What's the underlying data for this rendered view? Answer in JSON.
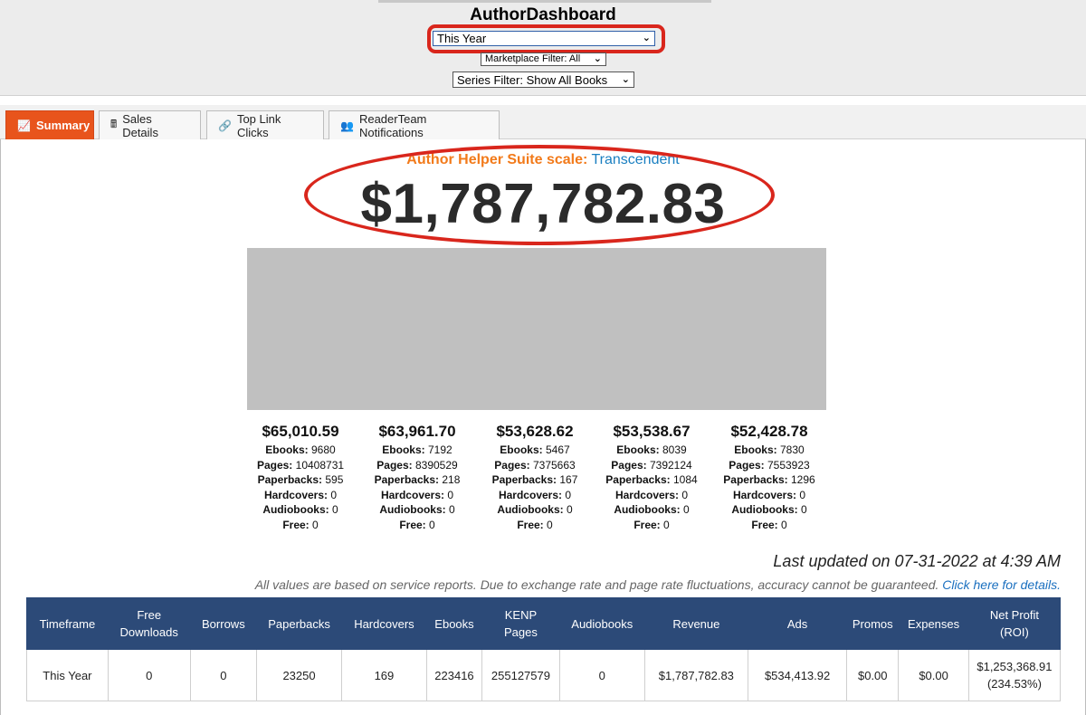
{
  "header": {
    "title": "AuthorDashboard",
    "timeframe_select": "This Year",
    "marketplace_select": "Marketplace Filter: All",
    "series_select": "Series Filter: Show All Books"
  },
  "tabs": [
    {
      "label": "Summary",
      "icon": "chart-line-icon",
      "active": true
    },
    {
      "label": "Sales Details",
      "icon": "cash-register-icon"
    },
    {
      "label": "Top Link Clicks",
      "icon": "link-icon"
    },
    {
      "label": "ReaderTeam Notifications",
      "icon": "people-icon"
    }
  ],
  "summary": {
    "scale_label": "Author Helper Suite scale:",
    "scale_value": "Transcendent",
    "total": "$1,787,782.83"
  },
  "cards": [
    {
      "amount": "$65,010.59",
      "ebooks": "9680",
      "pages": "10408731",
      "paperbacks": "595",
      "hardcovers": "0",
      "audiobooks": "0",
      "free": "0"
    },
    {
      "amount": "$63,961.70",
      "ebooks": "7192",
      "pages": "8390529",
      "paperbacks": "218",
      "hardcovers": "0",
      "audiobooks": "0",
      "free": "0"
    },
    {
      "amount": "$53,628.62",
      "ebooks": "5467",
      "pages": "7375663",
      "paperbacks": "167",
      "hardcovers": "0",
      "audiobooks": "0",
      "free": "0"
    },
    {
      "amount": "$53,538.67",
      "ebooks": "8039",
      "pages": "7392124",
      "paperbacks": "1084",
      "hardcovers": "0",
      "audiobooks": "0",
      "free": "0"
    },
    {
      "amount": "$52,428.78",
      "ebooks": "7830",
      "pages": "7553923",
      "paperbacks": "1296",
      "hardcovers": "0",
      "audiobooks": "0",
      "free": "0"
    }
  ],
  "card_labels": {
    "ebooks": "Ebooks:",
    "pages": "Pages:",
    "paperbacks": "Paperbacks:",
    "hardcovers": "Hardcovers:",
    "audiobooks": "Audiobooks:",
    "free": "Free:"
  },
  "status": {
    "last_updated": "Last updated on 07-31-2022 at 4:39 AM",
    "disclaimer": "All values are based on service reports. Due to exchange rate and page rate fluctuations, accuracy cannot be guaranteed.",
    "details_link": "Click here for details."
  },
  "table": {
    "headers": {
      "timeframe": "Timeframe",
      "free_downloads_1": "Free",
      "free_downloads_2": "Downloads",
      "borrows": "Borrows",
      "paperbacks": "Paperbacks",
      "hardcovers": "Hardcovers",
      "ebooks": "Ebooks",
      "kenp_1": "KENP",
      "kenp_2": "Pages",
      "audiobooks": "Audiobooks",
      "revenue": "Revenue",
      "ads": "Ads",
      "promos": "Promos",
      "expenses": "Expenses",
      "net_profit_1": "Net Profit",
      "net_profit_2": "(ROI)"
    },
    "row": {
      "timeframe": "This Year",
      "free_downloads": "0",
      "borrows": "0",
      "paperbacks": "23250",
      "hardcovers": "169",
      "ebooks": "223416",
      "kenp_pages": "255127579",
      "audiobooks": "0",
      "revenue": "$1,787,782.83",
      "ads": "$534,413.92",
      "promos": "$0.00",
      "expenses": "$0.00",
      "net_profit": "$1,253,368.91",
      "roi": "(234.53%)"
    }
  },
  "colors": {
    "accent_orange": "#e8541c",
    "highlight_red": "#d9261c",
    "table_header_navy": "#2c4a78",
    "scale_label_orange": "#f27a1a",
    "scale_value_blue": "#1a7fc1"
  }
}
